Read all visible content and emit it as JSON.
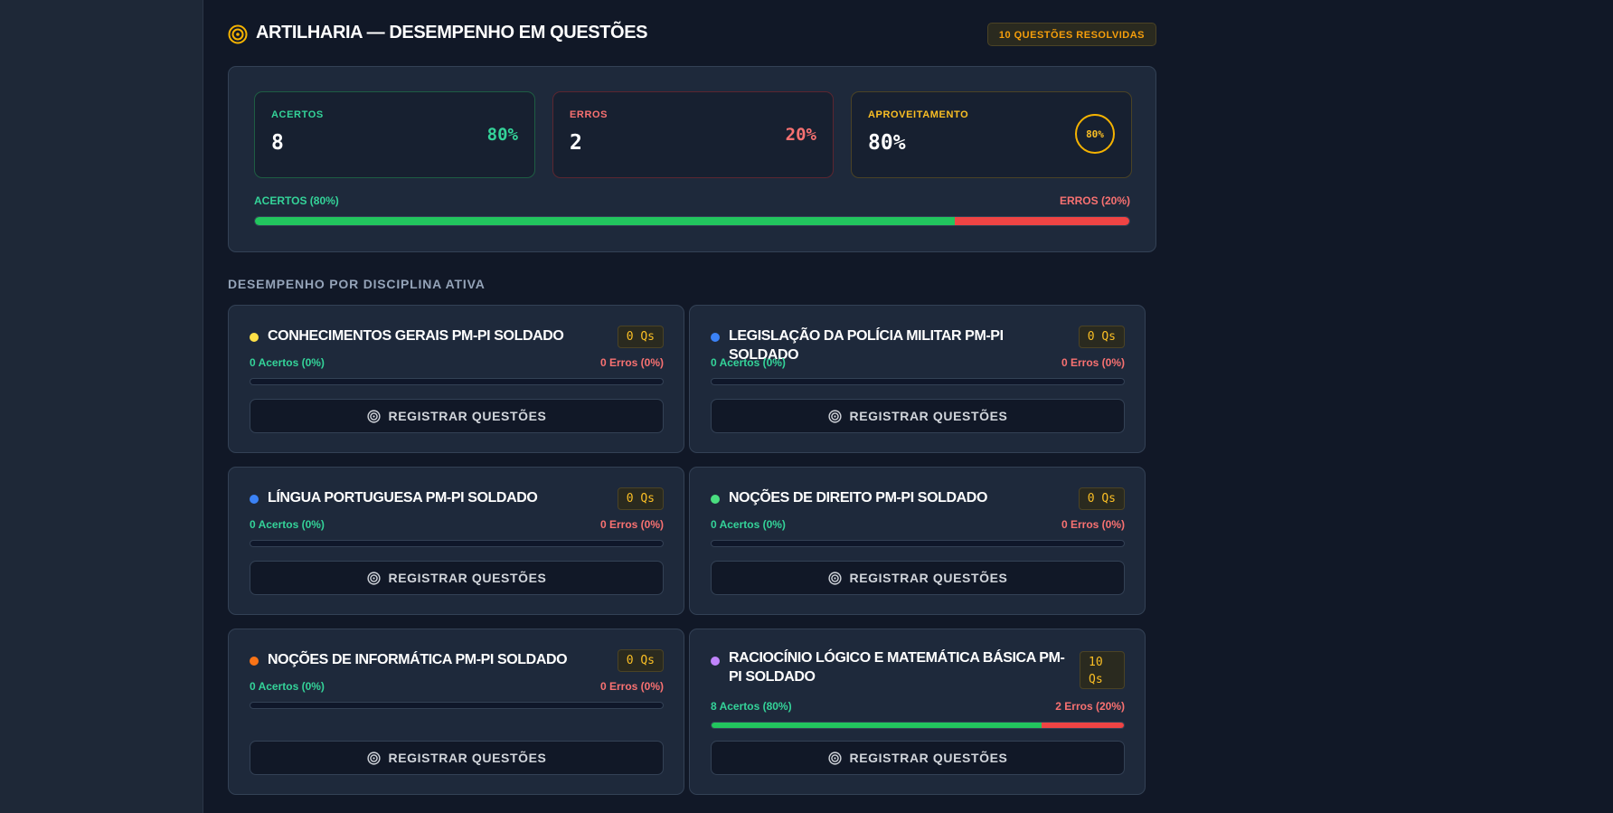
{
  "header": {
    "title": "ARTILHARIA — DESEMPENHO EM QUESTÕES",
    "badge": "10 QUESTÕES RESOLVIDAS"
  },
  "summary": {
    "hits": {
      "label": "ACERTOS",
      "value": "8",
      "pct": "80%"
    },
    "errors": {
      "label": "ERROS",
      "value": "2",
      "pct": "20%"
    },
    "rate": {
      "label": "APROVEITAMENTO",
      "value": "80%",
      "ring": "80%"
    },
    "legend_hits": "ACERTOS (80%)",
    "legend_errors": "ERROS (20%)",
    "hit_fraction": 0.8
  },
  "section_title": "DESEMPENHO POR DISCIPLINA ATIVA",
  "button_label": "REGISTRAR QUESTÕES",
  "colors": {
    "hit": "#22c55e",
    "error": "#ef4444",
    "accent": "#f5b301"
  },
  "disciplines": [
    {
      "name": "CONHECIMENTOS GERAIS PM-PI SOLDADO",
      "qs": "0 Qs",
      "hits": "0 Acertos (0%)",
      "errors": "0 Erros (0%)",
      "dot": "#fde047",
      "hit_fraction": 0,
      "err_fraction": 0
    },
    {
      "name": "LEGISLAÇÃO DA POLÍCIA MILITAR PM-PI SOLDADO",
      "qs": "0 Qs",
      "hits": "0 Acertos (0%)",
      "errors": "0 Erros (0%)",
      "dot": "#3b82f6",
      "hit_fraction": 0,
      "err_fraction": 0
    },
    {
      "name": "LÍNGUA PORTUGUESA PM-PI SOLDADO",
      "qs": "0 Qs",
      "hits": "0 Acertos (0%)",
      "errors": "0 Erros (0%)",
      "dot": "#3b82f6",
      "hit_fraction": 0,
      "err_fraction": 0
    },
    {
      "name": "NOÇÕES DE DIREITO PM-PI SOLDADO",
      "qs": "0 Qs",
      "hits": "0 Acertos (0%)",
      "errors": "0 Erros (0%)",
      "dot": "#4ade80",
      "hit_fraction": 0,
      "err_fraction": 0
    },
    {
      "name": "NOÇÕES DE INFORMÁTICA PM-PI SOLDADO",
      "qs": "0 Qs",
      "hits": "0 Acertos (0%)",
      "errors": "0 Erros (0%)",
      "dot": "#f97316",
      "hit_fraction": 0,
      "err_fraction": 0
    },
    {
      "name": "RACIOCÍNIO LÓGICO E MATEMÁTICA BÁSICA PM-PI SOLDADO",
      "qs": "10 Qs",
      "hits": "8 Acertos (80%)",
      "errors": "2 Erros (20%)",
      "dot": "#c084fc",
      "hit_fraction": 0.8,
      "err_fraction": 0.2
    }
  ]
}
